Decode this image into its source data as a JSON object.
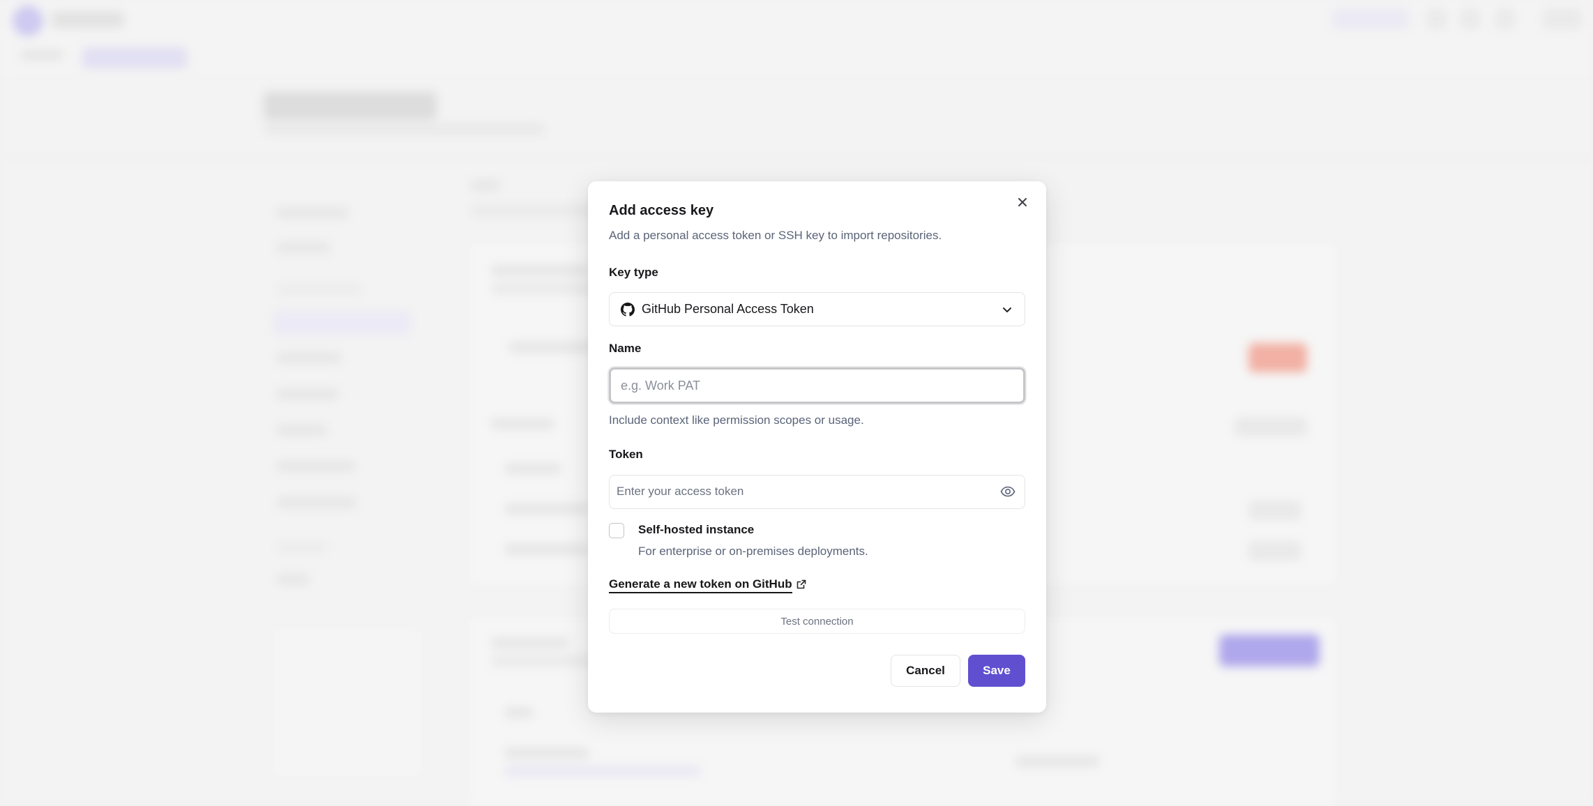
{
  "modal": {
    "title": "Add access key",
    "description": "Add a personal access token or SSH key to import repositories.",
    "close_icon": "close-icon",
    "key_type": {
      "label": "Key type",
      "selected": "GitHub Personal Access Token",
      "icon": "github-icon",
      "chevron_icon": "chevron-down-icon"
    },
    "name": {
      "label": "Name",
      "value": "",
      "placeholder": "e.g. Work PAT",
      "hint": "Include context like permission scopes or usage."
    },
    "token": {
      "label": "Token",
      "value": "",
      "placeholder": "Enter your access token",
      "toggle_icon": "eye-icon"
    },
    "self_hosted": {
      "label": "Self-hosted instance",
      "description": "For enterprise or on-premises deployments.",
      "checked": false
    },
    "generate_link": {
      "label": "Generate a new token on GitHub",
      "icon": "external-link-icon"
    },
    "test_connection_label": "Test connection",
    "cancel_label": "Cancel",
    "save_label": "Save"
  },
  "colors": {
    "accent": "#6050d0",
    "text": "#18181b",
    "muted": "#5a6478",
    "border": "#e4e4e7"
  }
}
